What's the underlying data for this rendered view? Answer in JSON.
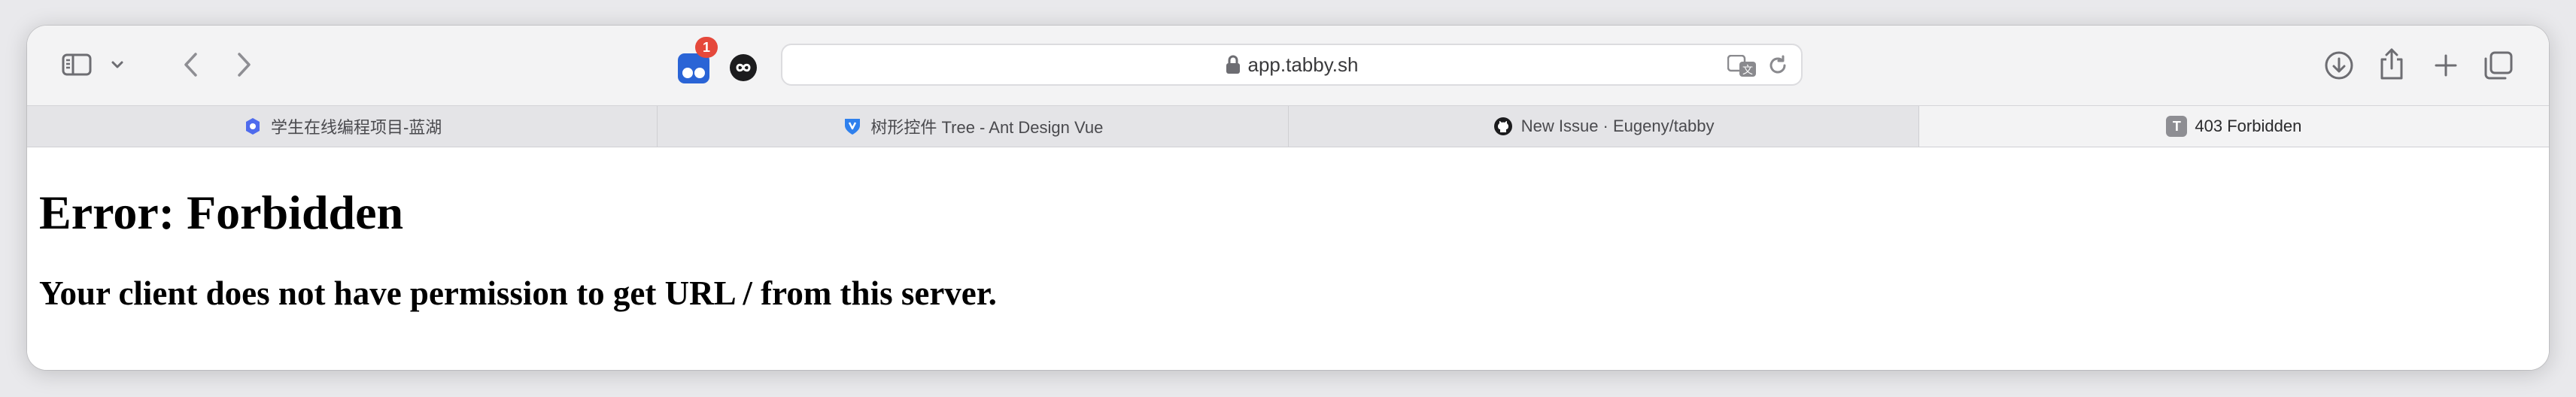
{
  "browser": {
    "address": "app.tabby.sh",
    "extension_badge": "1"
  },
  "tabs": [
    {
      "label": "学生在线编程项目-蓝湖",
      "icon": "lanhu-icon",
      "active": false
    },
    {
      "label": "树形控件 Tree - Ant Design Vue",
      "icon": "antdv-icon",
      "active": false
    },
    {
      "label": "New Issue · Eugeny/tabby",
      "icon": "github-icon",
      "active": false
    },
    {
      "label": "403 Forbidden",
      "icon": "letter-t-icon",
      "favicon_letter": "T",
      "active": true
    }
  ],
  "page": {
    "heading": "Error: Forbidden",
    "message": "Your client does not have permission to get URL / from this server."
  },
  "colors": {
    "badge": "#e5483b",
    "extension_blue": "#2a64d6"
  }
}
